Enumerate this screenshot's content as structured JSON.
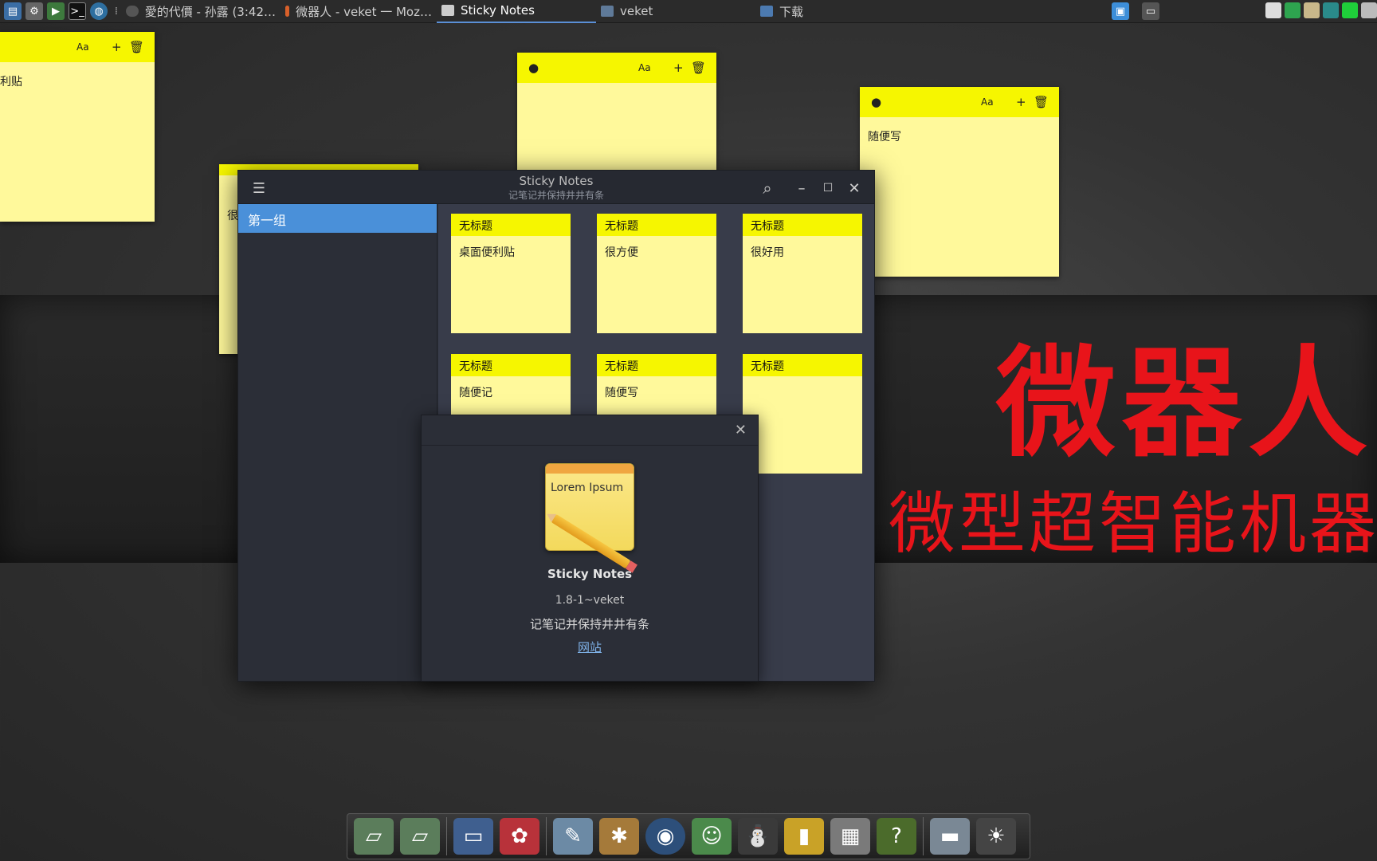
{
  "panel": {
    "tasks": [
      {
        "label": "愛的代價 - 孙露 (3:42…"
      },
      {
        "label": "微器人 - veket 一 Moz…"
      },
      {
        "label": "Sticky Notes"
      },
      {
        "label": "veket"
      },
      {
        "label": "下载"
      }
    ]
  },
  "desktop_notes": [
    {
      "body": "利贴"
    },
    {
      "body": ""
    },
    {
      "body": "随便写"
    },
    {
      "body": "很"
    }
  ],
  "window": {
    "title": "Sticky Notes",
    "subtitle": "记笔记并保持井井有条",
    "group": "第一组",
    "cards": [
      {
        "title": "无标题",
        "body": "桌面便利贴"
      },
      {
        "title": "无标题",
        "body": "很方便"
      },
      {
        "title": "无标题",
        "body": "很好用"
      },
      {
        "title": "无标题",
        "body": "随便记"
      },
      {
        "title": "无标题",
        "body": "随便写"
      },
      {
        "title": "无标题",
        "body": ""
      }
    ]
  },
  "about": {
    "icon_text": "Lorem Ipsum",
    "name": "Sticky Notes",
    "version": "1.8-1~veket",
    "description": "记笔记并保持井井有条",
    "link": "网站"
  },
  "wallpaper": {
    "line1": "微器人",
    "line2": "微型超智能机器"
  },
  "colors": {
    "note_header": "#f6f600",
    "note_body": "#fff99b",
    "selection": "#4a90d9",
    "wall_text": "#e8141a"
  }
}
